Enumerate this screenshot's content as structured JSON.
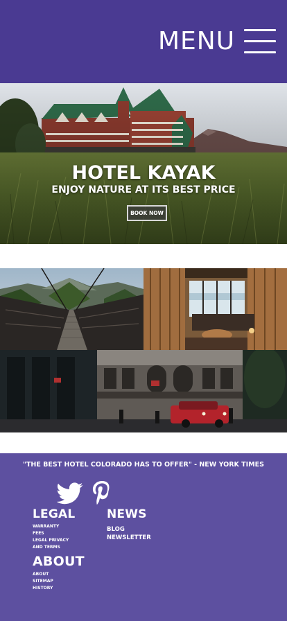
{
  "header": {
    "menu_label": "MENU",
    "menu_icon": "hamburger-icon",
    "background": "#4a3a92"
  },
  "hero": {
    "title": "HOTEL KAYAK",
    "subtitle": "ENJOY NATURE AT ITS BEST PRICE",
    "book_button": "BOOK NOW"
  },
  "gallery": {
    "images": [
      "bridge-photo",
      "lounge-photo",
      "street-photo"
    ]
  },
  "footer": {
    "background": "#5d50a0",
    "quote": "\"THE BEST HOTEL COLORADO HAS TO OFFER\" - NEW YORK TIMES",
    "social": [
      "twitter-icon",
      "pinterest-icon"
    ],
    "legal": {
      "heading": "LEGAL",
      "links": [
        "WARRANTY",
        "FEES",
        "LEGAL PRIVACY",
        "AND TERMS"
      ]
    },
    "news": {
      "heading": "NEWS",
      "links": [
        "BLOG",
        "NEWSLETTER"
      ]
    },
    "about": {
      "heading": "ABOUT",
      "links": [
        "ABOUT",
        "SITEMAP",
        "HISTORY"
      ]
    }
  }
}
